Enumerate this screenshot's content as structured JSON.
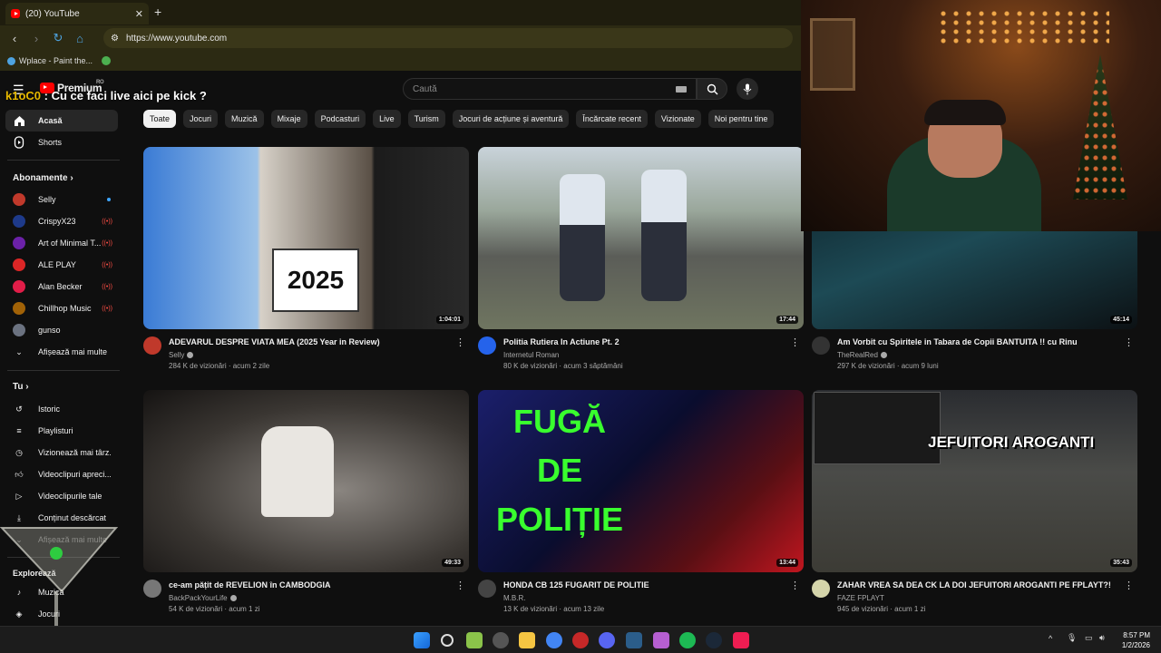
{
  "browser": {
    "tab_title": "(20) YouTube",
    "url": "https://www.youtube.com",
    "bookmarks": [
      "Wplace - Paint the..."
    ]
  },
  "overlay": {
    "user": "k1oC0",
    "message": " : Cu ce faci live aici pe kick ?"
  },
  "header": {
    "logo": "Premium",
    "logo_sup": "RO",
    "search_placeholder": "Caută"
  },
  "chips": [
    "Toate",
    "Jocuri",
    "Muzică",
    "Mixaje",
    "Podcasturi",
    "Live",
    "Turism",
    "Jocuri de acțiune și aventură",
    "Încărcate recent",
    "Vizionate",
    "Noi pentru tine"
  ],
  "sidebar": {
    "home": "Acasă",
    "shorts": "Shorts",
    "subs_heading": "Abonamente",
    "subscriptions": [
      {
        "name": "Selly",
        "color": "#c0392b"
      },
      {
        "name": "CrispyX23",
        "color": "#1e3a8a"
      },
      {
        "name": "Art of Minimal T...",
        "color": "#6b21a8"
      },
      {
        "name": "ALE PLAY",
        "color": "#dc2626"
      },
      {
        "name": "Alan Becker",
        "color": "#e11d48"
      },
      {
        "name": "Chillhop Music",
        "color": "#a16207"
      },
      {
        "name": "gunso",
        "color": "#6b7280"
      }
    ],
    "show_more": "Afișează mai multe",
    "you_heading": "Tu",
    "you_items": [
      "Istoric",
      "Playlisturi",
      "Vizionează mai târz...",
      "Videoclipuri apreci...",
      "Videoclipurile tale",
      "Conținut descărcat",
      "Afișează mai multe"
    ],
    "explore_heading": "Explorează",
    "explore_items": [
      "Muzică",
      "Jocuri"
    ]
  },
  "videos": [
    {
      "title": "ADEVARUL DESPRE VIATA MEA (2025 Year in Review)",
      "channel": "Selly",
      "verified": true,
      "stats": "284 K de vizionări · acum 2 zile",
      "duration": "1:04:01",
      "thumb_text": "2025",
      "av": "#c0392b"
    },
    {
      "title": "Politia Rutiera In Actiune Pt. 2",
      "channel": "Internetul Roman",
      "verified": false,
      "stats": "80 K de vizionări · acum 3 săptămâni",
      "duration": "17:44",
      "thumb_text": "",
      "av": "#2563eb"
    },
    {
      "title": "Am Vorbit cu Spiritele in Tabara de Copii BANTUITA !! cu Rinu",
      "channel": "TheRealRed",
      "verified": true,
      "stats": "297 K de vizionări · acum 9 luni",
      "duration": "45:14",
      "thumb_text": "",
      "av": "#333333"
    },
    {
      "title": "ce-am pățit de REVELION în CAMBODGIA",
      "channel": "BackPackYourLife",
      "verified": true,
      "stats": "54 K de vizionări · acum 1 zi",
      "duration": "49:33",
      "thumb_text": "",
      "av": "#777777"
    },
    {
      "title": "HONDA CB 125 FUGARIT DE POLITIE",
      "channel": "M.B.R.",
      "verified": false,
      "stats": "13 K de vizionări · acum 13 zile",
      "duration": "13:44",
      "thumb_text": "FUGĂ DE POLIȚIE",
      "av": "#444444"
    },
    {
      "title": "ZAHAR VREA SA DEA CK LA DOI JEFUITORI AROGANTI PE FPLAYT?!",
      "channel": "FAZE FPLAYT",
      "verified": false,
      "stats": "945 de vizionări · acum 1 zi",
      "duration": "35:43",
      "thumb_text": "JEFUITORI AROGANTI",
      "av": "#d4d4aa"
    }
  ],
  "taskbar": {
    "time": "8:57 PM",
    "date": "1/2/2026"
  }
}
